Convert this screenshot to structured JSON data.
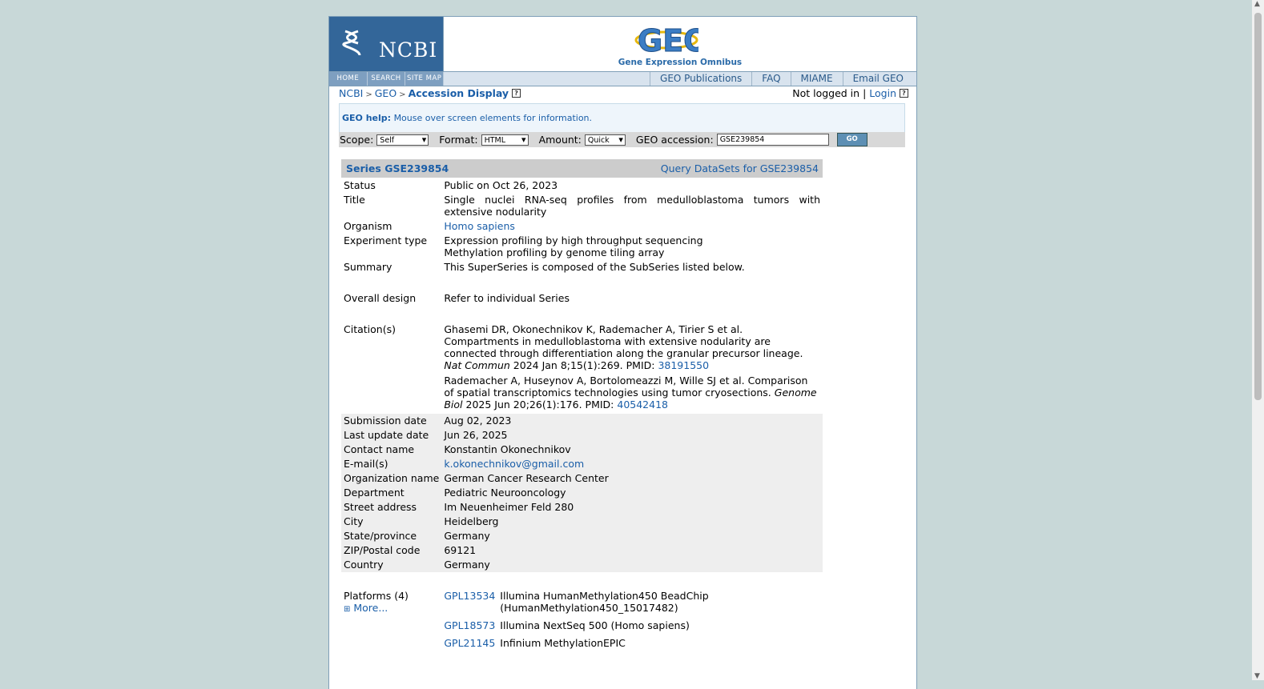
{
  "header": {
    "ncbi_label": "NCBI",
    "geo_logo_text": "GEO",
    "geo_subtitle": "Gene Expression Omnibus",
    "left_nav": [
      "HOME",
      "SEARCH",
      "SITE MAP"
    ],
    "right_nav": [
      "GEO Publications",
      "FAQ",
      "MIAME",
      "Email GEO"
    ]
  },
  "breadcrumb": {
    "ncbi": "NCBI",
    "geo": "GEO",
    "current": "Accession Display",
    "sep": ">"
  },
  "login": {
    "status": "Not logged in",
    "sep": "|",
    "link": "Login"
  },
  "help": {
    "label": "GEO help:",
    "text": "Mouse over screen elements for information."
  },
  "form": {
    "scope_label": "Scope:",
    "scope_value": "Self",
    "format_label": "Format:",
    "format_value": "HTML",
    "amount_label": "Amount:",
    "amount_value": "Quick",
    "accession_label": "GEO accession:",
    "accession_value": "GSE239854",
    "go_label": "GO"
  },
  "series": {
    "title": "Series GSE239854",
    "query": "Query DataSets for GSE239854"
  },
  "details": {
    "status": {
      "k": "Status",
      "v": "Public on Oct 26, 2023"
    },
    "title": {
      "k": "Title",
      "v": "Single nuclei RNA-seq profiles from medulloblastoma tumors with extensive nodularity"
    },
    "organism": {
      "k": "Organism",
      "v": "Homo sapiens"
    },
    "experiment": {
      "k": "Experiment type",
      "v1": "Expression profiling by high throughput sequencing",
      "v2": "Methylation profiling by genome tiling array"
    },
    "summary": {
      "k": "Summary",
      "v": "This SuperSeries is composed of the SubSeries listed below."
    },
    "design": {
      "k": "Overall design",
      "v": "Refer to individual Series"
    },
    "citation": {
      "k": "Citation(s)",
      "c1_text": "Ghasemi DR, Okonechnikov K, Rademacher A, Tirier S et al. Compartments in medulloblastoma with extensive nodularity are connected through differentiation along the granular precursor lineage.",
      "c1_journal": "Nat Commun",
      "c1_tail": "2024 Jan 8;15(1):269. PMID:",
      "c1_pmid": "38191550",
      "c2_text": "Rademacher A, Huseynov A, Bortolomeazzi M, Wille SJ et al. Comparison of spatial transcriptomics technologies using tumor cryosections.",
      "c2_journal": "Genome Biol",
      "c2_tail": "2025 Jun 20;26(1):176. PMID:",
      "c2_pmid": "40542418"
    },
    "contact": [
      {
        "k": "Submission date",
        "v": "Aug 02, 2023"
      },
      {
        "k": "Last update date",
        "v": "Jun 26, 2025"
      },
      {
        "k": "Contact name",
        "v": "Konstantin Okonechnikov"
      },
      {
        "k": "E-mail(s)",
        "v": "k.okonechnikov@gmail.com"
      },
      {
        "k": "Organization name",
        "v": "German Cancer Research Center"
      },
      {
        "k": "Department",
        "v": "Pediatric Neurooncology"
      },
      {
        "k": "Street address",
        "v": "Im Neuenheimer Feld 280"
      },
      {
        "k": "City",
        "v": "Heidelberg"
      },
      {
        "k": "State/province",
        "v": "Germany"
      },
      {
        "k": "ZIP/Postal code",
        "v": "69121"
      },
      {
        "k": "Country",
        "v": "Germany"
      }
    ],
    "platforms": {
      "k": "Platforms (4)",
      "more": "More...",
      "items": [
        {
          "id": "GPL13534",
          "name": "Illumina HumanMethylation450 BeadChip (HumanMethylation450_15017482)"
        },
        {
          "id": "GPL18573",
          "name": "Illumina NextSeq 500 (Homo sapiens)"
        },
        {
          "id": "GPL21145",
          "name": "Infinium MethylationEPIC"
        }
      ]
    }
  },
  "colors": {
    "link": "#1a5ea8",
    "ncbi_blue": "#336699",
    "page_bg": "#c8d8d8"
  }
}
